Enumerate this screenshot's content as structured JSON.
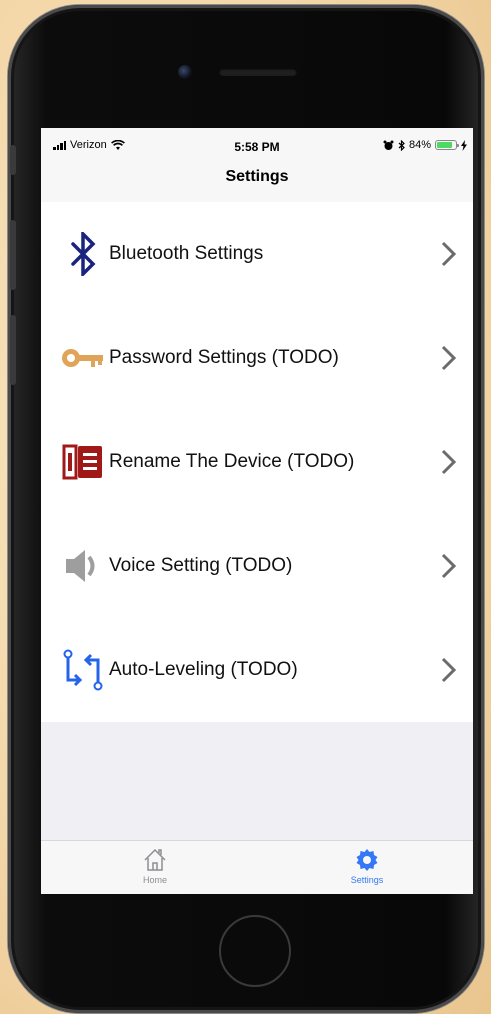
{
  "status_bar": {
    "carrier": "Verizon",
    "time": "5:58 PM",
    "battery_percent": "84%",
    "battery_level": 0.84
  },
  "nav": {
    "title": "Settings"
  },
  "settings_items": [
    {
      "label": "Bluetooth Settings",
      "icon": "bluetooth-icon",
      "color": "#1a237e"
    },
    {
      "label": "Password Settings (TODO)",
      "icon": "key-icon",
      "color": "#e0a458"
    },
    {
      "label": "Rename The Device (TODO)",
      "icon": "notebook-icon",
      "color": "#a01818"
    },
    {
      "label": "Voice Setting (TODO)",
      "icon": "speaker-icon",
      "color": "#9e9e9e"
    },
    {
      "label": "Auto-Leveling (TODO)",
      "icon": "sync-arrows-icon",
      "color": "#2563eb"
    }
  ],
  "tab_bar": {
    "tabs": [
      {
        "label": "Home",
        "icon": "home-icon",
        "active": false
      },
      {
        "label": "Settings",
        "icon": "gear-icon",
        "active": true
      }
    ],
    "active_color": "#3478f6",
    "inactive_color": "#8e8e93"
  }
}
